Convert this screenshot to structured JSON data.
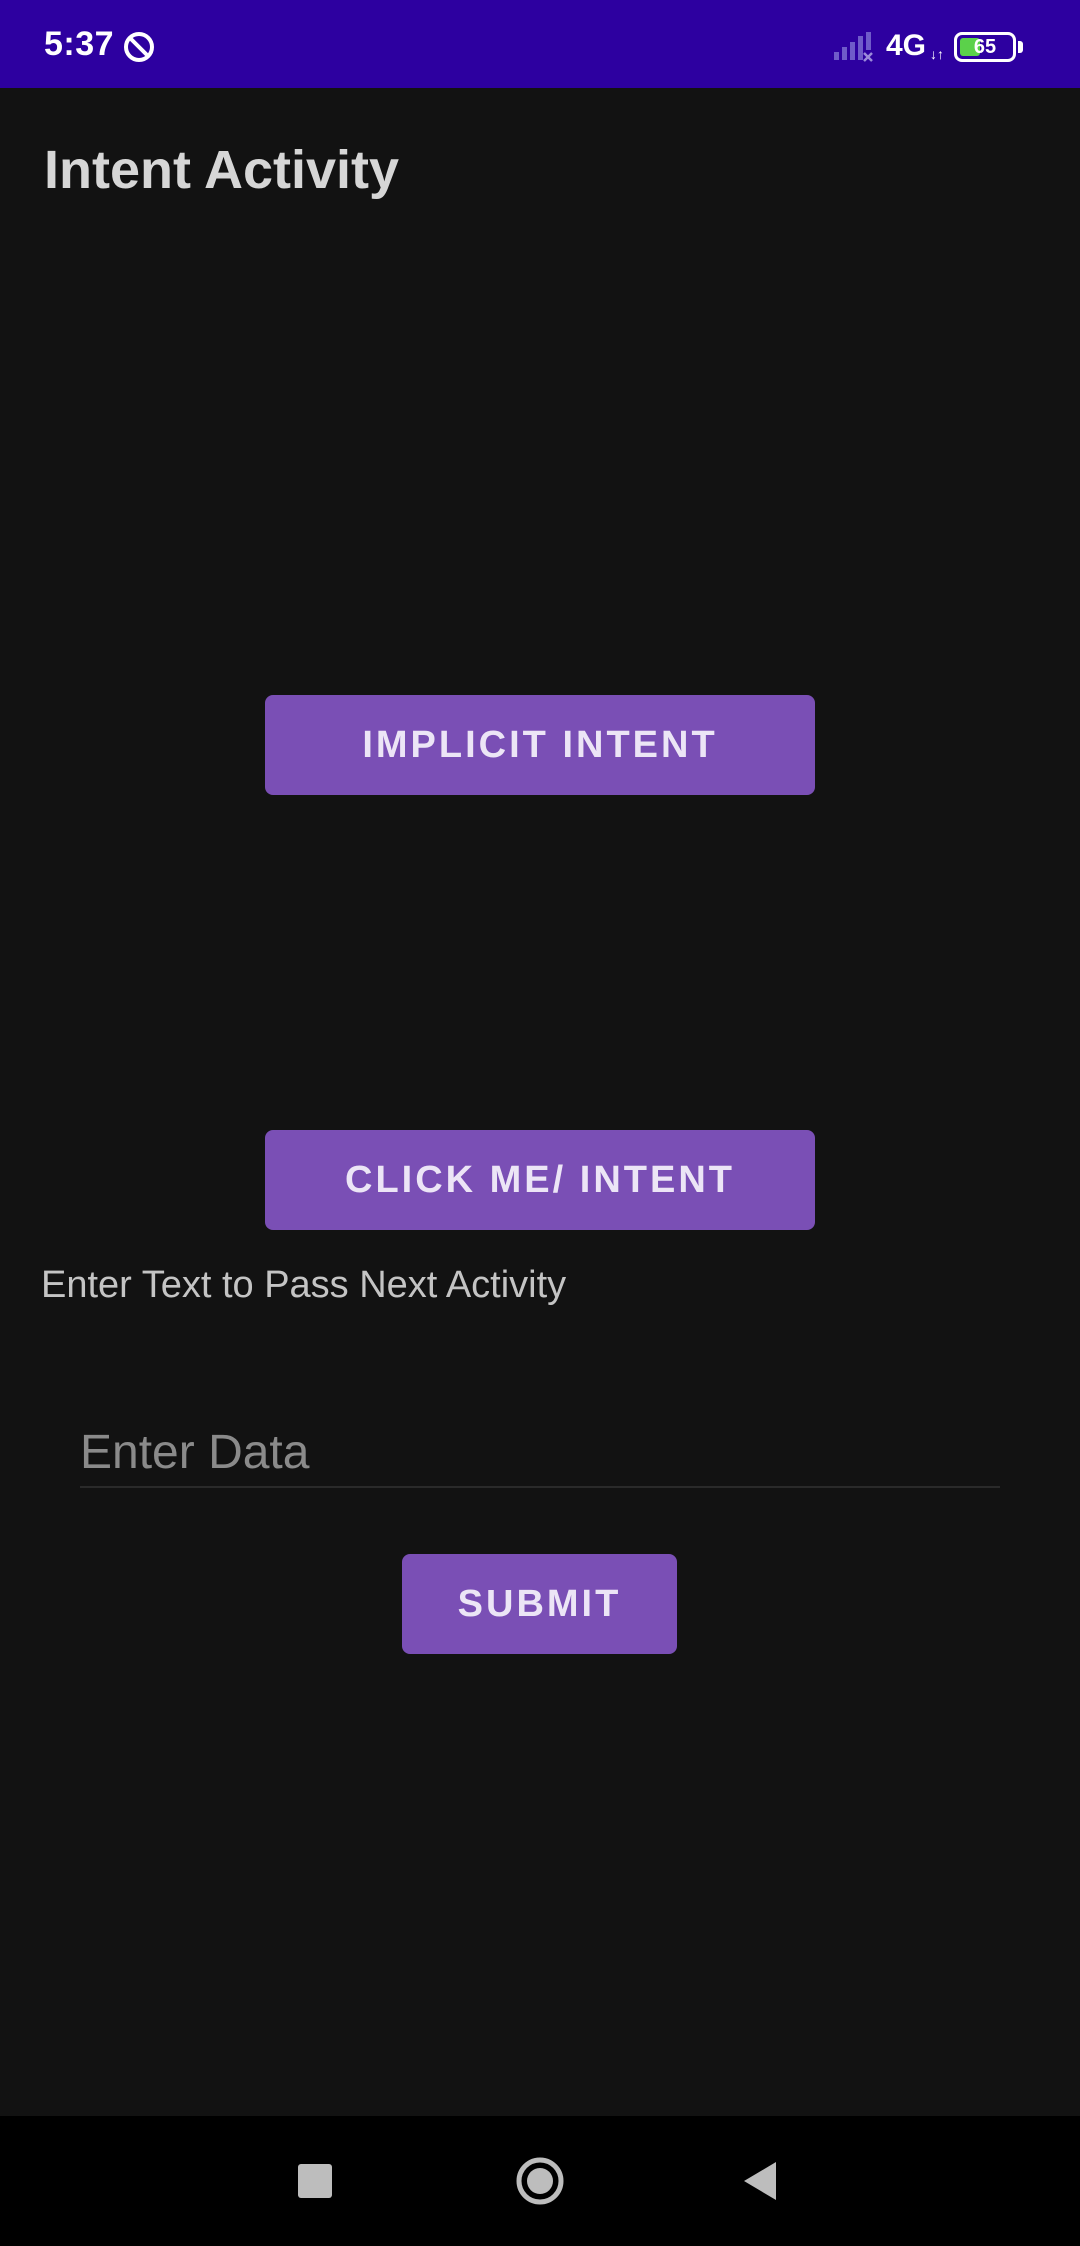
{
  "status_bar": {
    "time": "5:37",
    "network": "4G",
    "network_arrows": "↓↑",
    "battery_level": "65",
    "icons": [
      "do-not-disturb-icon",
      "signal-strength-icon",
      "battery-icon"
    ],
    "background_color": "#2d00a0"
  },
  "app": {
    "title": "Intent Activity"
  },
  "main": {
    "implicit_intent_label": "IMPLICIT INTENT",
    "click_me_intent_label": "CLICK ME/ INTENT",
    "prompt_text": "Enter Text to Pass Next Activity",
    "data_input": {
      "value": "",
      "placeholder": "Enter Data"
    },
    "submit_label": "SUBMIT"
  },
  "nav_bar": {
    "icons": [
      "recents-icon",
      "home-icon",
      "back-icon"
    ]
  },
  "colors": {
    "background": "#121212",
    "button": "#7a4fb5",
    "status_bar": "#2d00a0",
    "nav_bar": "#000000"
  }
}
